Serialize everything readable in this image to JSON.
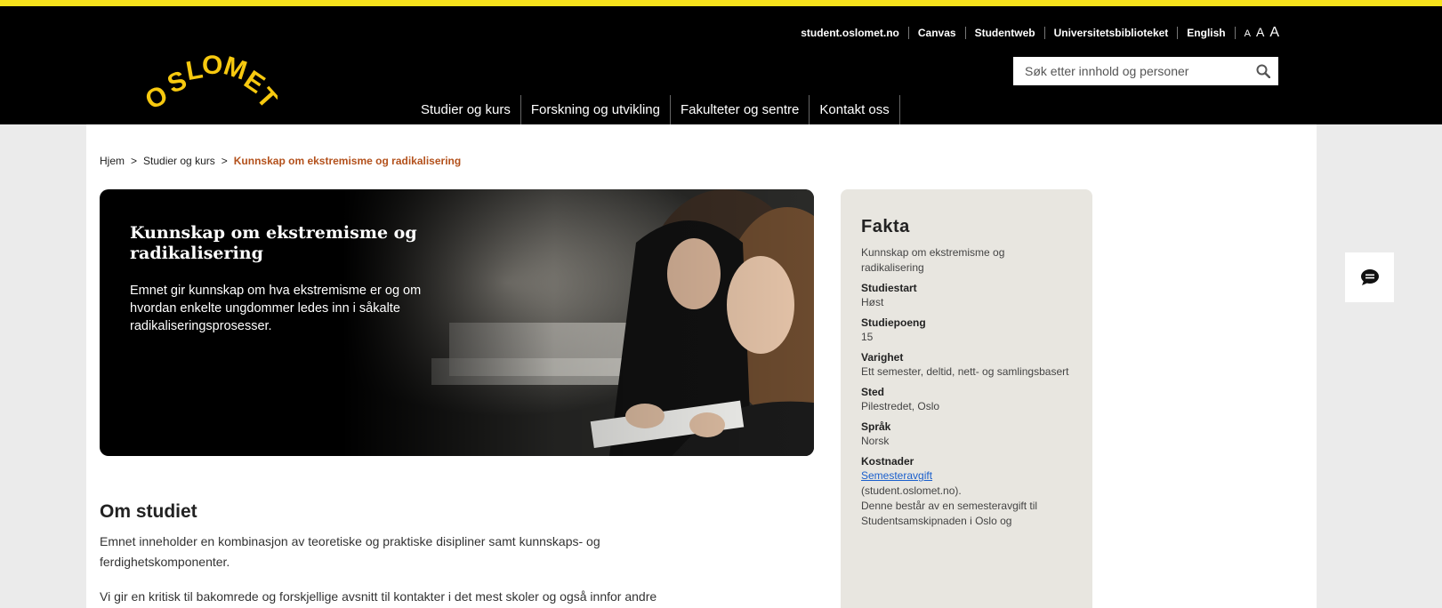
{
  "header": {
    "top_links": [
      "student.oslomet.no",
      "Canvas",
      "Studentweb",
      "Universitetsbiblioteket",
      "English"
    ],
    "font_sizes": [
      "A",
      "A",
      "A"
    ],
    "search_placeholder": "Søk etter innhold og personer",
    "logo_text": "OSLOMET",
    "nav": [
      "Studier og kurs",
      "Forskning og utvikling",
      "Fakulteter og sentre",
      "Kontakt oss"
    ]
  },
  "breadcrumb": {
    "home": "Hjem",
    "sep": ">",
    "parent": "Studier og kurs",
    "current": "Kunnskap om ekstremisme og radikalisering"
  },
  "hero": {
    "title": "Kunnskap om ekstremisme og radikalisering",
    "lead": "Emnet gir kunnskap om hva ekstremisme er og om hvordan enkelte ungdommer ledes inn i såkalte radikaliseringsprosesser."
  },
  "about": {
    "title": "Om studiet",
    "text": "Emnet inneholder en kombinasjon av teoretiske og praktiske disipliner samt kunnskaps- og ferdighetskomponenter.",
    "text2": "Vi gir en kritisk til bakomrede og forskjellige avsnitt til kontakter i det mest skoler og også innfor andre"
  },
  "facts": {
    "title": "Fakta",
    "intro": "Kunnskap om ekstremisme og radikalisering",
    "studiestart_label": "Studiestart",
    "studiestart": "Høst",
    "studiepoeng_label": "Studiepoeng",
    "studiepoeng": "15",
    "varighet_label": "Varighet",
    "varighet": "Ett semester, deltid, nett- og samlingsbasert",
    "sted_label": "Sted",
    "sted": "Pilestredet, Oslo",
    "sprak_label": "Språk",
    "sprak": "Norsk",
    "kostnader_label": "Kostnader",
    "kostnader_link": "Semesteravgift",
    "kostnader_text1": "(student.oslomet.no).",
    "kostnader_text2": "Denne består av en semesteravgift til Studentsamskipnaden i Oslo og"
  },
  "colors": {
    "accent_yellow": "#f7e21c",
    "breadcrumb_current": "#b3511c",
    "link_blue": "#1a5fcc"
  },
  "icons": [
    "search-icon",
    "chat-icon"
  ]
}
